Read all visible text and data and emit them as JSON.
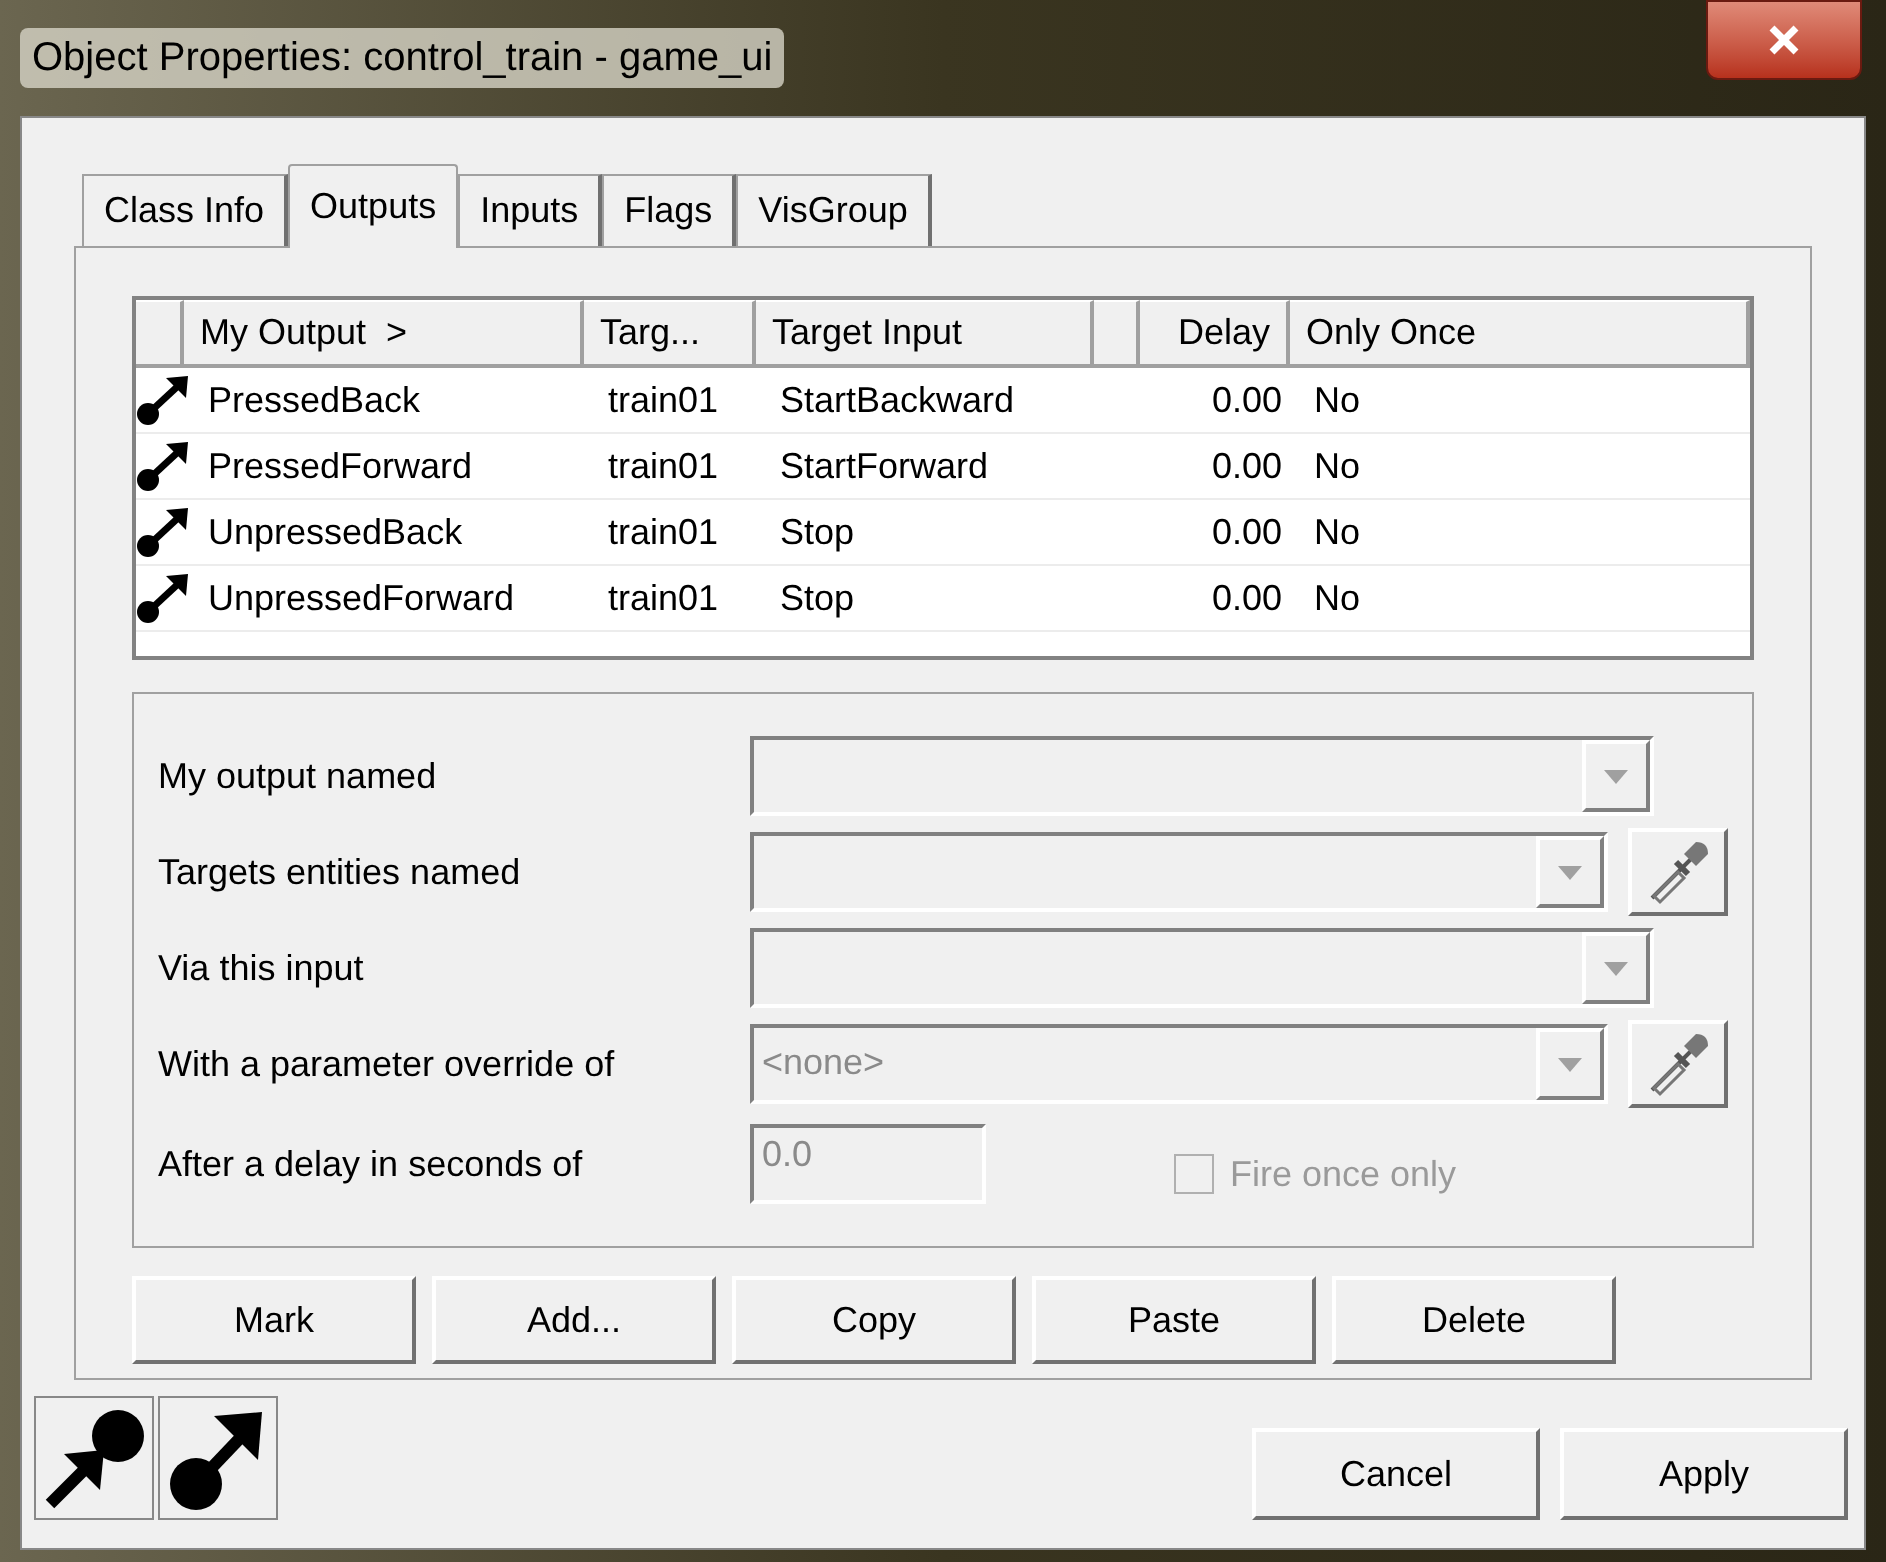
{
  "window": {
    "title": "Object Properties: control_train - game_ui"
  },
  "tabs": [
    {
      "label": "Class Info",
      "selected": false
    },
    {
      "label": "Outputs",
      "selected": true
    },
    {
      "label": "Inputs",
      "selected": false
    },
    {
      "label": "Flags",
      "selected": false
    },
    {
      "label": "VisGroup",
      "selected": false
    }
  ],
  "table": {
    "columns": [
      "My Output  >",
      "Targ...",
      "Target Input",
      null,
      "Delay",
      "Only Once"
    ],
    "rows": [
      [
        "PressedBack",
        "train01",
        "StartBackward",
        null,
        "0.00",
        "No"
      ],
      [
        "PressedForward",
        "train01",
        "StartForward",
        null,
        "0.00",
        "No"
      ],
      [
        "UnpressedBack",
        "train01",
        "Stop",
        null,
        "0.00",
        "No"
      ],
      [
        "UnpressedForward",
        "train01",
        "Stop",
        null,
        "0.00",
        "No"
      ]
    ]
  },
  "editor": {
    "fields": [
      {
        "label": "My output named",
        "has_picker": false
      },
      {
        "label": "Targets entities named",
        "has_picker": true
      },
      {
        "label": "Via this input",
        "has_picker": false
      },
      {
        "label": "With a parameter override of",
        "value": "<none>",
        "has_picker": true
      }
    ],
    "delay": {
      "label": "After a delay in seconds of",
      "value": "0.0"
    },
    "fire_once": {
      "label": "Fire once only",
      "checked": false,
      "disabled": true
    }
  },
  "actions": [
    "Mark",
    "Add...",
    "Copy",
    "Paste",
    "Delete"
  ],
  "footer_buttons": [
    "Cancel",
    "Apply"
  ]
}
